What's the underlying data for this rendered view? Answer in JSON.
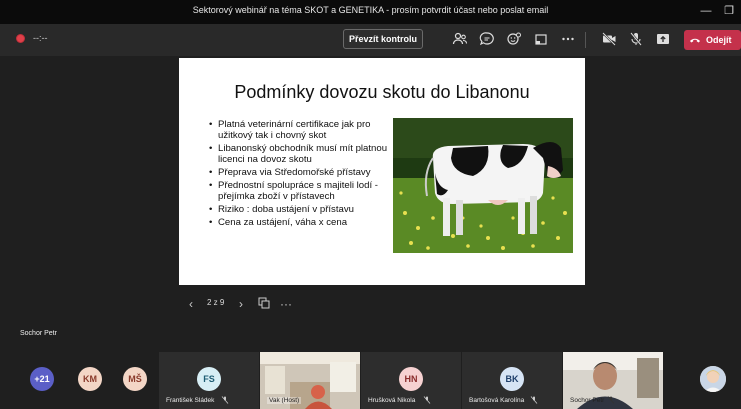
{
  "window": {
    "title": "Sektorový webinář na téma SKOT a GENETIKA - prosím potvrdit účast nebo poslat email",
    "minimize_icon": "minimize-icon",
    "restore_icon": "restore-icon"
  },
  "toolbar": {
    "timer": "--:--",
    "take_control_label": "Převzít kontrolu",
    "leave_label": "Odejít",
    "icons": [
      "people-icon",
      "chat-icon",
      "reactions-icon",
      "share-tray-icon",
      "more-icon",
      "camera-off-icon",
      "mic-off-icon",
      "share-icon",
      "phone-hangup-icon"
    ]
  },
  "slide": {
    "title": "Podmínky dovozu skotu do Libanonu",
    "bullets": [
      "Platná veterinární certifikace jak pro užitkový tak i chovný skot",
      "Libanonský obchodník musí mít platnou licenci na dovoz skotu",
      "Přeprava via Středomořské přístavy",
      "Přednostní spolupráce s majiteli lodí  - přejímka zboží v přístavech",
      "Riziko : doba ustájení v přístavu",
      "Cena za ustájení, váha x cena"
    ]
  },
  "slide_nav": {
    "page_indicator": "2 z 9"
  },
  "presenter": {
    "name": "Sochor Petr"
  },
  "participants": {
    "overflow": "+21",
    "avatars": [
      {
        "initials": "KM",
        "color": "#f3d6c6"
      },
      {
        "initials": "MŠ",
        "color": "#f3d6c6"
      }
    ],
    "tiles": [
      {
        "initials": "FS",
        "name": "František Sládek",
        "color": "#d7eef5"
      },
      {
        "name": "Vak (Host)"
      },
      {
        "initials": "HN",
        "name": "Hrušková Nikola",
        "color": "#f6d1d1"
      },
      {
        "initials": "BK",
        "name": "Bartošová Karolína",
        "color": "#d6e4f5"
      },
      {
        "name": "Sochor Petr"
      }
    ]
  },
  "colors": {
    "leave": "#c4314b",
    "background": "#1f1f1f",
    "toolbar": "#292929",
    "overflow_avatar": "#5b5fc7"
  }
}
